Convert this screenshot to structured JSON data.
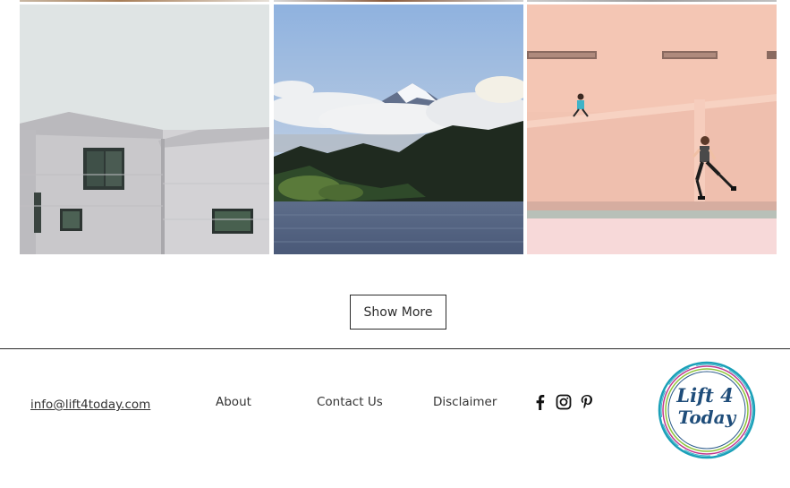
{
  "gallery": {
    "items": [
      {
        "alt": "building-image"
      },
      {
        "alt": "mountain-lake-image"
      },
      {
        "alt": "runners-image"
      }
    ],
    "show_more_label": "Show More"
  },
  "footer": {
    "email": "info@lift4today.com",
    "nav": [
      {
        "label": "About"
      },
      {
        "label": "Contact Us"
      },
      {
        "label": "Disclaimer"
      }
    ],
    "social": [
      "facebook-icon",
      "instagram-icon",
      "pinterest-icon"
    ],
    "logo_text": "Lift 4 Today"
  }
}
